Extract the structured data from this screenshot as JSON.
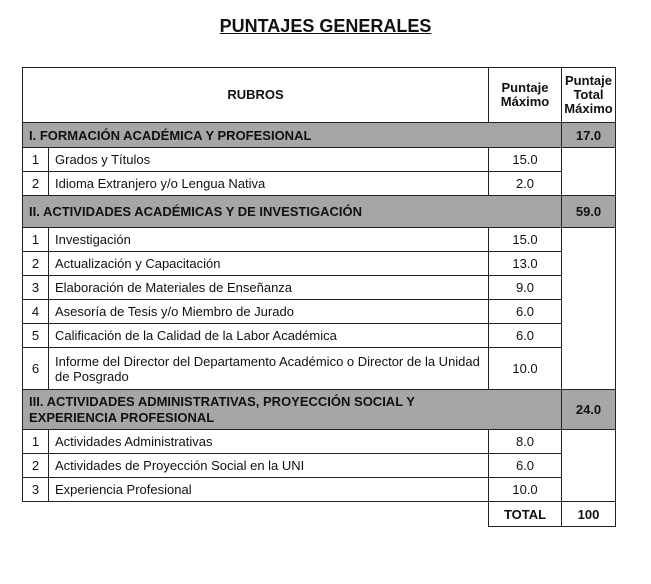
{
  "title": "PUNTAJES GENERALES",
  "headers": {
    "rubros": "RUBROS",
    "puntaje_maximo": "Puntaje Máximo",
    "puntaje_total_maximo": "Puntaje Total Máximo"
  },
  "sections": [
    {
      "label": "I.   FORMACIÓN ACADÉMICA Y PROFESIONAL",
      "total": "17.0",
      "items": [
        {
          "num": "1",
          "name": "Grados y Títulos",
          "score": "15.0"
        },
        {
          "num": "2",
          "name": "Idioma Extranjero y/o Lengua Nativa",
          "score": "2.0"
        }
      ]
    },
    {
      "label": "II. ACTIVIDADES ACADÉMICAS Y DE INVESTIGACIÓN",
      "total": "59.0",
      "items": [
        {
          "num": "1",
          "name": "Investigación",
          "score": "15.0"
        },
        {
          "num": "2",
          "name": "Actualización y Capacitación",
          "score": "13.0"
        },
        {
          "num": "3",
          "name": "Elaboración de Materiales de Enseñanza",
          "score": "9.0"
        },
        {
          "num": "4",
          "name": "Asesoría de Tesis y/o Miembro de Jurado",
          "score": "6.0"
        },
        {
          "num": "5",
          "name": "Calificación de la Calidad de la Labor Académica",
          "score": "6.0"
        },
        {
          "num": "6",
          "name": "Informe del Director del Departamento Académico o Director de la Unidad de Posgrado",
          "score": "10.0"
        }
      ]
    },
    {
      "label": "III. ACTIVIDADES ADMINISTRATIVAS, PROYECCIÓN SOCIAL Y EXPERIENCIA PROFESIONAL",
      "total": "24.0",
      "items": [
        {
          "num": "1",
          "name": "Actividades Administrativas",
          "score": "8.0"
        },
        {
          "num": "2",
          "name": "Actividades de Proyección Social en la UNI",
          "score": "6.0"
        },
        {
          "num": "3",
          "name": "Experiencia Profesional",
          "score": "10.0"
        }
      ]
    }
  ],
  "total": {
    "label": "TOTAL",
    "value": "100"
  },
  "colors": {
    "section_fill": "#a6a6a6"
  }
}
